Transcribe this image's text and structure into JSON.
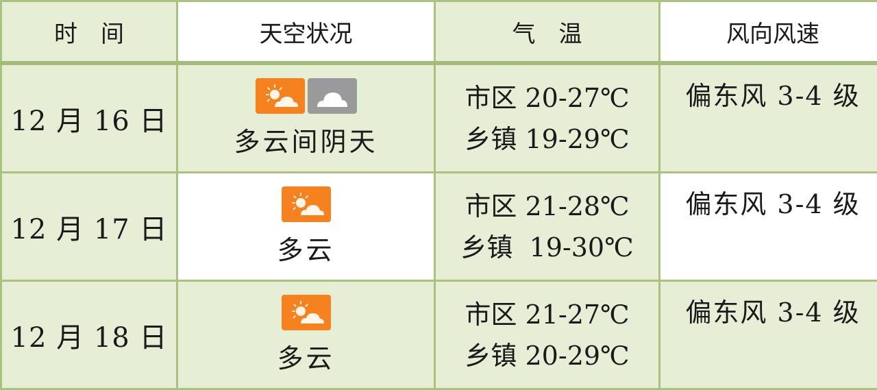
{
  "table": {
    "headers": [
      "时　间",
      "天空状况",
      "气　温",
      "风向风速"
    ],
    "rows": [
      {
        "date": "12 月 16 日",
        "sky_icons": [
          "partly-cloudy-icon",
          "overcast-icon"
        ],
        "sky_text": "多云间阴天",
        "temp_city": "市区 20-27℃",
        "temp_town": "乡镇 19-29℃",
        "wind": "偏东风 3-4 级"
      },
      {
        "date": "12 月 17 日",
        "sky_icons": [
          "partly-cloudy-icon"
        ],
        "sky_text": "多云",
        "temp_city": "市区 21-28℃",
        "temp_town": "乡镇  19-30℃",
        "wind": "偏东风 3-4 级"
      },
      {
        "date": "12 月 18 日",
        "sky_icons": [
          "partly-cloudy-icon"
        ],
        "sky_text": "多云",
        "temp_city": "市区 21-27℃",
        "temp_town": "乡镇 20-29℃",
        "wind": "偏东风 3-4 级"
      }
    ]
  },
  "colors": {
    "cell_green": "#e6eed6",
    "border": "#a9c27e",
    "icon_orange": "#f5821f",
    "icon_gray": "#9a9a9a"
  }
}
